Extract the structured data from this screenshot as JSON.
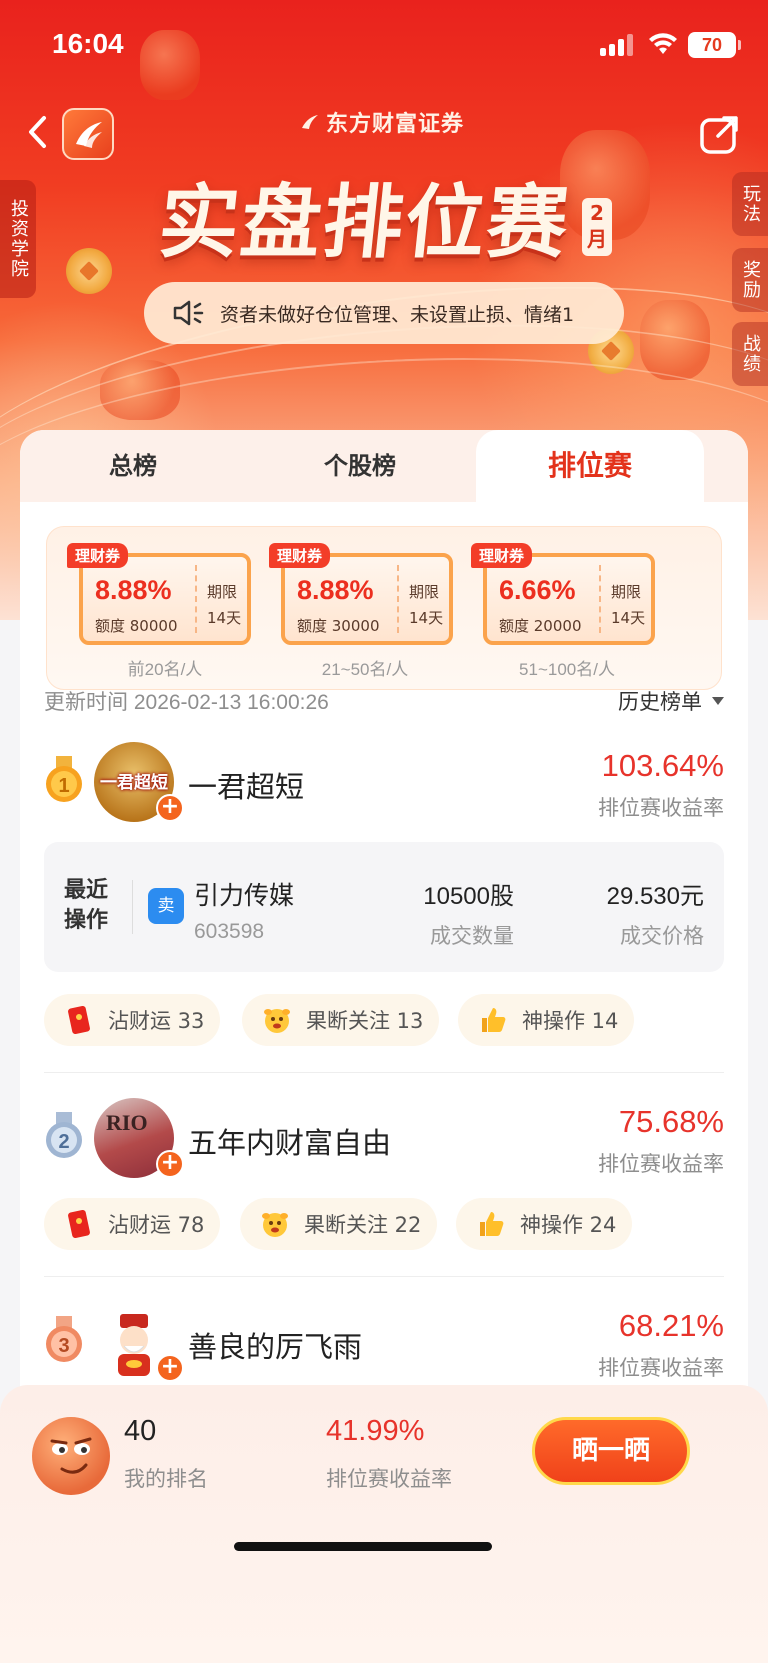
{
  "status_bar": {
    "time": "16:04",
    "battery": "70"
  },
  "header": {
    "brand": "东方财富证券",
    "title": "实盘排位赛",
    "month_tag": "2月",
    "notice": "资者未做好仓位管理、未设置止损、情绪1"
  },
  "side_left": {
    "label": "投资学院"
  },
  "side_right": [
    {
      "label": "玩法"
    },
    {
      "label": "奖励"
    },
    {
      "label": "战绩"
    }
  ],
  "tabs": [
    {
      "label": "总榜"
    },
    {
      "label": "个股榜"
    },
    {
      "label": "排位赛"
    }
  ],
  "coupons": [
    {
      "tag": "理财券",
      "rate": "8.88%",
      "amount": "额度 80000",
      "term_label": "期限",
      "term": "14天",
      "rank_range": "前20名/人"
    },
    {
      "tag": "理财券",
      "rate": "8.88%",
      "amount": "额度 30000",
      "term_label": "期限",
      "term": "14天",
      "rank_range": "21~50名/人"
    },
    {
      "tag": "理财券",
      "rate": "6.66%",
      "amount": "额度 20000",
      "term_label": "期限",
      "term": "14天",
      "rank_range": "51~100名/人"
    }
  ],
  "update": {
    "text": "更新时间 2026-02-13 16:00:26",
    "history": "历史榜单"
  },
  "leaderboard": [
    {
      "rank": "1",
      "name": "一君超短",
      "avatar_text": "一君超短",
      "return": "103.64%",
      "return_label": "排位赛收益率",
      "recent_op": {
        "label": "最近操作",
        "action": "卖",
        "stock": "引力传媒",
        "code": "603598",
        "qty": "10500股",
        "qty_label": "成交数量",
        "price": "29.530元",
        "price_label": "成交价格"
      },
      "chips": [
        {
          "icon": "red-envelope-icon",
          "label": "沾财运 33"
        },
        {
          "icon": "salute-emoji-icon",
          "label": "果断关注 13"
        },
        {
          "icon": "thumbs-up-icon",
          "label": "神操作 14"
        }
      ]
    },
    {
      "rank": "2",
      "name": "五年内财富自由",
      "avatar_text": "RIO",
      "return": "75.68%",
      "return_label": "排位赛收益率",
      "chips": [
        {
          "icon": "red-envelope-icon",
          "label": "沾财运 78"
        },
        {
          "icon": "salute-emoji-icon",
          "label": "果断关注 22"
        },
        {
          "icon": "thumbs-up-icon",
          "label": "神操作 24"
        }
      ]
    },
    {
      "rank": "3",
      "name": "善良的厉飞雨",
      "return": "68.21%",
      "return_label": "排位赛收益率"
    }
  ],
  "my_stats": {
    "rank": "40",
    "rank_label": "我的排名",
    "return": "41.99%",
    "return_label": "排位赛收益率",
    "share_button": "晒一晒"
  },
  "colors": {
    "accent_red": "#e7332b",
    "hero_red": "#e9221d",
    "coupon_orange": "#fba34c"
  }
}
